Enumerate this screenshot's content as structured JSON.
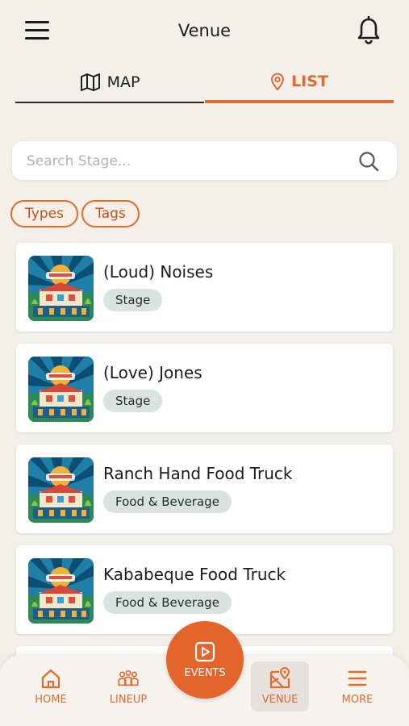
{
  "header": {
    "title": "Venue"
  },
  "tabs": [
    {
      "label": "MAP",
      "icon": "map-icon",
      "active": false
    },
    {
      "label": "LIST",
      "icon": "location-pin-icon",
      "active": true
    }
  ],
  "search": {
    "placeholder": "Search Stage...",
    "value": ""
  },
  "filters": {
    "types_label": "Types",
    "tags_label": "Tags"
  },
  "venues": [
    {
      "name": "(Loud) Noises",
      "type": "Stage"
    },
    {
      "name": "(Love) Jones",
      "type": "Stage"
    },
    {
      "name": "Ranch Hand Food Truck",
      "type": "Food & Beverage"
    },
    {
      "name": "Kababeque Food Truck",
      "type": "Food & Beverage"
    }
  ],
  "nav": {
    "home": "HOME",
    "lineup": "LINEUP",
    "events": "EVENTS",
    "venue": "VENUE",
    "more": "MORE",
    "active": "VENUE"
  },
  "colors": {
    "accent": "#e46a2c",
    "background": "#f3efe9",
    "tag_bg": "#d9e4e2"
  }
}
